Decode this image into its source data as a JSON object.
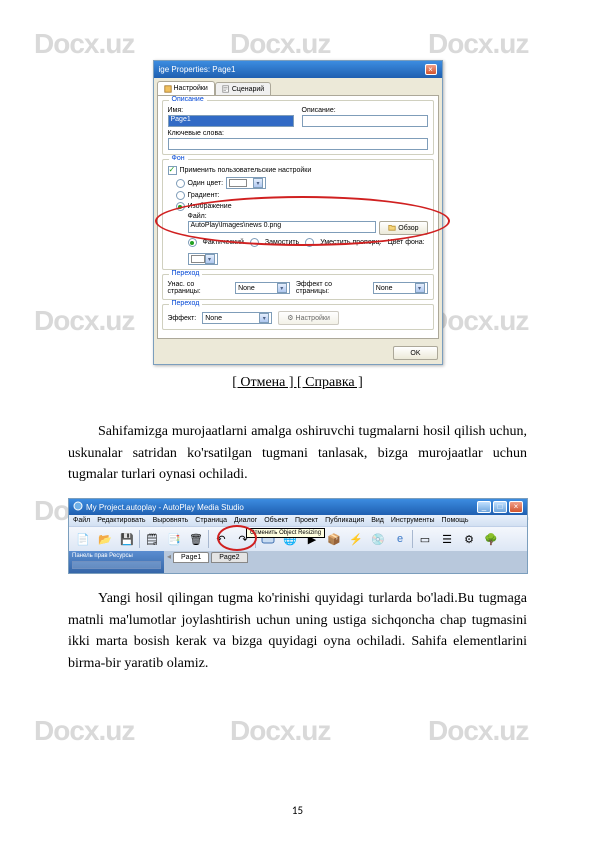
{
  "watermark": "Docx.uz",
  "dialog": {
    "title": "ige Properties: Page1",
    "tabs": {
      "settings": "Настройки",
      "script": "Сценарий"
    },
    "groups": {
      "description": {
        "title": "Описание",
        "name_label": "Имя:",
        "desc_label": "Описание:",
        "name_value": "Page1",
        "keywords_label": "Ключевые слова:"
      },
      "background": {
        "title": "Фон",
        "use_custom": "Применить пользовательские настройки",
        "single_color": "Один цвет:",
        "gradient": "Градиент:",
        "image_opt": "Изображение",
        "file_label": "Файл:",
        "file_value": "AutoPlay\\Images\\news 0.png",
        "browse": "Обзор",
        "fit_label": "Фактический",
        "tile_label": "Замостить",
        "stretch_label": "Уместить пропорц.",
        "bg_color_label": "Цвет фона:"
      },
      "transition": {
        "title": "Переход",
        "inherit_label": "Унас. со страницы:",
        "none": "None",
        "inherit_effect": "Эффект со страницы:"
      },
      "transition2": {
        "title": "Переход",
        "effect_label": "Эффект:",
        "none": "None",
        "settings_btn": "Настройки"
      }
    },
    "ok": "OK"
  },
  "caption": "[ Отмена ] [ Справка ]",
  "para1": "Sahifamizga murojaatlarni amalga oshiruvchi tugmalarni hosil qilish uchun, uskunalar satridan ko'rsatilgan tugmani tanlasak, bizga murojaatlar uchun tugmalar turlari oynasi ochiladi.",
  "toolbar": {
    "title": "My Project.autoplay - AutoPlay Media Studio",
    "menu": [
      "Файл",
      "Редактировать",
      "Выровнять",
      "Страница",
      "Диалог",
      "Объект",
      "Проект",
      "Публикация",
      "Вид",
      "Инструменты",
      "Помощь"
    ],
    "redo_hint": "Отменить Object Resizing",
    "left_panel": "Панель прав Ресурсы",
    "page_tabs": [
      "Page1",
      "Page2"
    ]
  },
  "para2": "Yangi hosil qilingan tugma ko'rinishi quyidagi turlarda bo'ladi.Bu tugmaga matnli ma'lumotlar joylashtirish uchun uning ustiga sichqoncha chap tugmasini ikki marta bosish kerak va bizga quyidagi oyna ochiladi. Sahifa elementlarini birma-bir yaratib olamiz.",
  "page_number": "15"
}
